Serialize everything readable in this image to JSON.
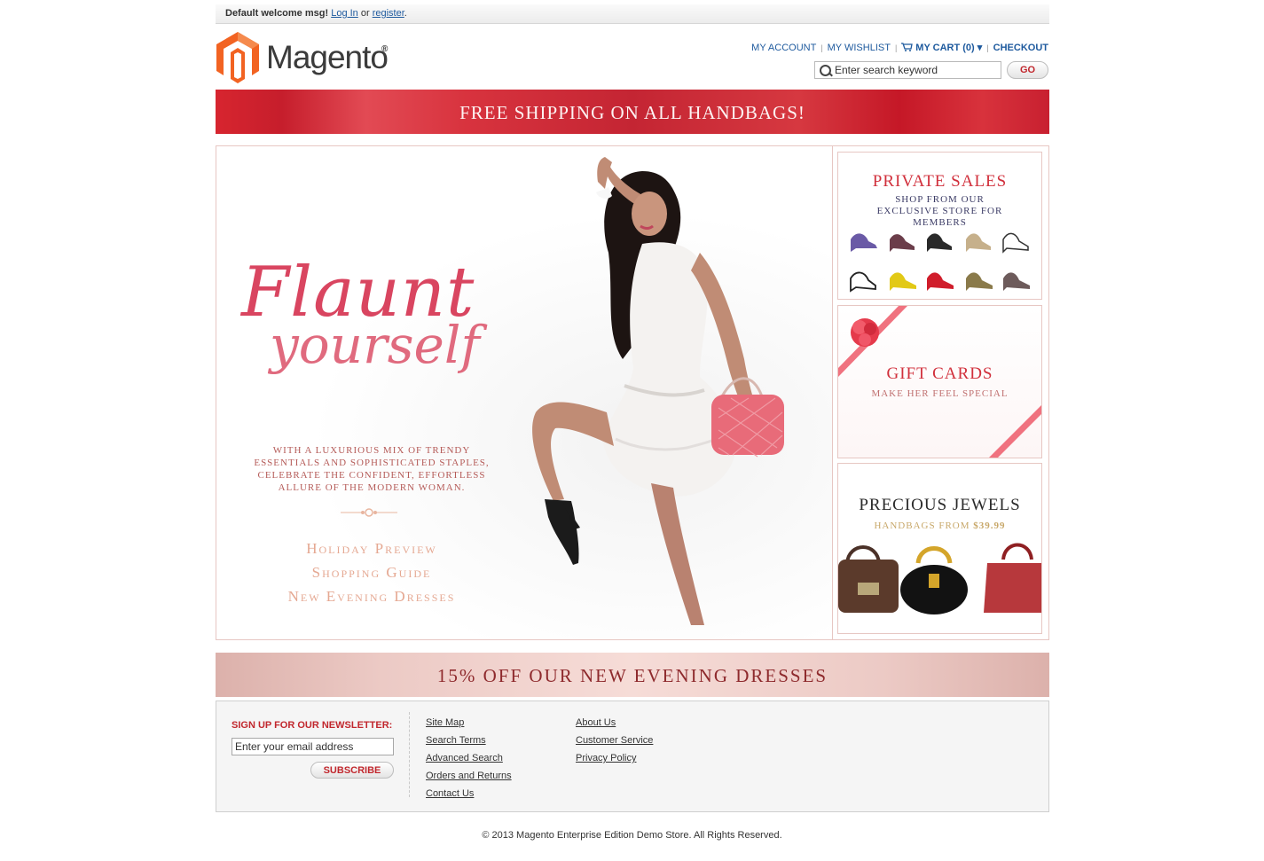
{
  "welcome": {
    "msg": "Default welcome msg!",
    "login": "Log In",
    "or": "or",
    "register": "register",
    "period": "."
  },
  "logo": {
    "text": "Magento",
    "reg": "®"
  },
  "toplinks": {
    "account": "MY ACCOUNT",
    "wishlist": "MY WISHLIST",
    "cart": "MY CART (0)",
    "cart_caret": "▾",
    "checkout": "CHECKOUT",
    "sep": "|"
  },
  "search": {
    "placeholder": "Enter search keyword",
    "go": "GO"
  },
  "ship_banner": "FREE SHIPPING ON ALL HANDBAGS!",
  "hero": {
    "title1": "Flaunt",
    "title2": "yourself",
    "blurb": "WITH A LUXURIOUS MIX OF TRENDY ESSENTIALS AND SOPHISTICATED STAPLES, CELEBRATE THE CONFIDENT, EFFORTLESS ALLURE OF THE MODERN WOMAN.",
    "links": [
      "Holiday Preview",
      "Shopping Guide",
      "New Evening Dresses"
    ]
  },
  "promos": {
    "private": {
      "title": "PRIVATE SALES",
      "sub": "SHOP FROM OUR EXCLUSIVE STORE FOR MEMBERS"
    },
    "gift": {
      "title": "GIFT CARDS",
      "sub": "MAKE HER FEEL SPECIAL"
    },
    "jewels": {
      "title": "PRECIOUS JEWELS",
      "sub_prefix": "HANDBAGS FROM ",
      "price": "$39.99"
    }
  },
  "dress_banner": "15% OFF OUR NEW EVENING DRESSES",
  "footer": {
    "newsletter_title": "SIGN UP FOR OUR NEWSLETTER:",
    "newsletter_placeholder": "Enter your email address",
    "subscribe": "SUBSCRIBE",
    "col1": [
      "Site Map",
      "Search Terms",
      "Advanced Search",
      "Orders and Returns",
      "Contact Us"
    ],
    "col2": [
      "About Us",
      "Customer Service",
      "Privacy Policy"
    ]
  },
  "copyright": "© 2013 Magento Enterprise Edition Demo Store. All Rights Reserved.",
  "colors": {
    "brand_orange": "#f26322",
    "accent_red": "#c1272d",
    "link_blue": "#1e5a9e",
    "pink": "#d94560"
  }
}
